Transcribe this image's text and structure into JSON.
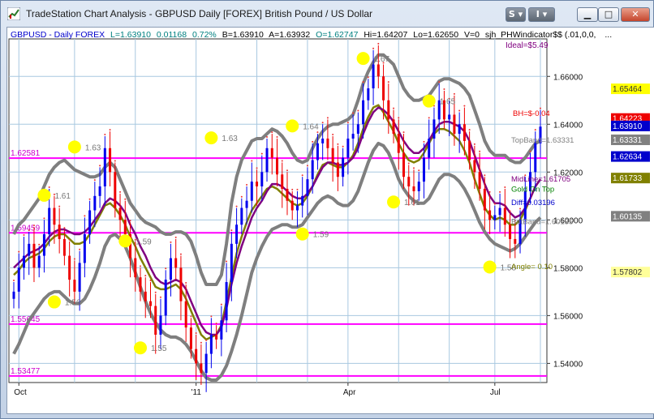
{
  "window": {
    "title": "TradeStation Chart Analysis - GBPUSD Daily [FOREX] British Pound / US Dollar",
    "buttons": {
      "s_label": "S",
      "i_label": "I",
      "minimize": "▁",
      "maximize": "□",
      "close": "✕"
    }
  },
  "header": {
    "symbol": "GBPUSD - Daily  FOREX",
    "last": "L=1.63910",
    "change": "0.01168",
    "pct": "0.72%",
    "bid": "B=1.63910",
    "ask": "A=1.63932",
    "open": "O=1.62747",
    "high": "Hi=1.64207",
    "low": "Lo=1.62650",
    "volume": "V=0",
    "indicator": "sjh_PHWindicator$$ (.01,0,0,",
    "indicator_more": "...",
    "ideal": "Ideal=$5.49"
  },
  "colors": {
    "up_bar": "#0000ee",
    "down_bar": "#ee0000",
    "band": "#7f7f7f",
    "midline": "#800080",
    "gold": "#808000",
    "hline": "#ff00ff",
    "dot": "#ffff00",
    "grid": "#a8c8e0"
  },
  "chart_data": {
    "type": "candlestick",
    "ylim": [
      1.532,
      1.675
    ],
    "y_ticks": [
      "1.66000",
      "1.64000",
      "1.62000",
      "1.60000",
      "1.58000",
      "1.56000",
      "1.54000"
    ],
    "x_ticks": [
      "Oct",
      "'11",
      "Apr",
      "Jul"
    ],
    "horizontal_lines": [
      {
        "label": "1.62581",
        "value": 1.62581
      },
      {
        "label": "1.59459",
        "value": 1.59459
      },
      {
        "label": "1.55645",
        "value": 1.55645
      },
      {
        "label": "1.53477",
        "value": 1.53477
      }
    ],
    "right_price_tags": [
      {
        "label": "1.65464",
        "value": 1.65464,
        "bg": "#ffff00",
        "fg": "#333333"
      },
      {
        "label": "1.64223",
        "value": 1.64223,
        "bg": "#ee0000",
        "fg": "#ffffff"
      },
      {
        "label": "1.63910",
        "value": 1.6391,
        "bg": "#0000cc",
        "fg": "#ffffff"
      },
      {
        "label": "1.63331",
        "value": 1.63331,
        "bg": "#808080",
        "fg": "#ffffff"
      },
      {
        "label": "1.62634",
        "value": 1.62634,
        "bg": "#0000cc",
        "fg": "#ffffff"
      },
      {
        "label": "1.61733",
        "value": 1.61733,
        "bg": "#808000",
        "fg": "#ffffff"
      },
      {
        "label": "1.60135",
        "value": 1.60135,
        "bg": "#808080",
        "fg": "#ffffff"
      },
      {
        "label": "1.57802",
        "value": 1.57802,
        "bg": "#ffff99",
        "fg": "#333333"
      }
    ],
    "swing_labels": [
      {
        "text": "1.61",
        "value": 1.6103
      },
      {
        "text": "1.56",
        "value": 1.5657
      },
      {
        "text": "1.63",
        "value": 1.6305
      },
      {
        "text": "1.59",
        "value": 1.5912
      },
      {
        "text": "1.55",
        "value": 1.5465
      },
      {
        "text": "1.63",
        "value": 1.6343
      },
      {
        "text": "1.64",
        "value": 1.6393
      },
      {
        "text": "1.59",
        "value": 1.5941
      },
      {
        "text": "1.67",
        "value": 1.6675
      },
      {
        "text": "1.65",
        "value": 1.6497
      },
      {
        "text": "1.61",
        "value": 1.6075
      },
      {
        "text": "1.58",
        "value": 1.5803
      }
    ],
    "annotations": [
      {
        "text": "BH=$-0.04",
        "color": "#ee0000"
      },
      {
        "text": "TopBand=1.63331",
        "color": "#808080"
      },
      {
        "text": "MidLine=1.61705",
        "color": "#800080"
      },
      {
        "text": "Gold On Top",
        "color": "#008000"
      },
      {
        "text": "Diff=0.03196",
        "color": "#0000cc"
      },
      {
        "text": "BotBand=1.60135",
        "color": "#808080"
      },
      {
        "text": "Angle= 0.10",
        "color": "#808000"
      }
    ],
    "series": [
      {
        "name": "close",
        "values": [
          1.57,
          1.58,
          1.585,
          1.59,
          1.58,
          1.585,
          1.594,
          1.605,
          1.598,
          1.592,
          1.585,
          1.575,
          1.57,
          1.582,
          1.594,
          1.604,
          1.61,
          1.614,
          1.63,
          1.62,
          1.605,
          1.6,
          1.594,
          1.584,
          1.576,
          1.57,
          1.566,
          1.564,
          1.552,
          1.56,
          1.575,
          1.584,
          1.58,
          1.566,
          1.555,
          1.546,
          1.54,
          1.536,
          1.544,
          1.552,
          1.55,
          1.558,
          1.574,
          1.59,
          1.598,
          1.605,
          1.608,
          1.616,
          1.614,
          1.62,
          1.63,
          1.626,
          1.619,
          1.613,
          1.608,
          1.604,
          1.606,
          1.61,
          1.617,
          1.625,
          1.632,
          1.634,
          1.63,
          1.624,
          1.618,
          1.626,
          1.634,
          1.636,
          1.64,
          1.65,
          1.655,
          1.665,
          1.66,
          1.65,
          1.642,
          1.636,
          1.628,
          1.618,
          1.614,
          1.612,
          1.616,
          1.626,
          1.634,
          1.642,
          1.65,
          1.642,
          1.644,
          1.636,
          1.64,
          1.633,
          1.625,
          1.62,
          1.613,
          1.604,
          1.6,
          1.602,
          1.605,
          1.598,
          1.592,
          1.59,
          1.6,
          1.612,
          1.62,
          1.632,
          1.639
        ]
      }
    ],
    "bands": {
      "top": [
        1.594,
        1.598,
        1.6,
        1.603,
        1.606,
        1.609,
        1.614,
        1.619,
        1.622,
        1.624,
        1.625,
        1.623,
        1.621,
        1.62,
        1.619,
        1.618,
        1.618,
        1.619,
        1.622,
        1.624,
        1.622,
        1.617,
        1.612,
        1.607,
        1.604,
        1.601,
        1.599,
        1.598,
        1.597,
        1.595,
        1.594,
        1.594,
        1.595,
        1.595,
        1.594,
        1.591,
        1.585,
        1.578,
        1.573,
        1.573,
        1.573,
        1.577,
        1.59,
        1.607,
        1.618,
        1.625,
        1.629,
        1.633,
        1.634,
        1.634,
        1.636,
        1.638,
        1.637,
        1.635,
        1.632,
        1.628,
        1.625,
        1.624,
        1.625,
        1.63,
        1.634,
        1.637,
        1.639,
        1.64,
        1.64,
        1.641,
        1.642,
        1.644,
        1.65,
        1.657,
        1.662,
        1.666,
        1.669,
        1.669,
        1.667,
        1.665,
        1.66,
        1.655,
        1.652,
        1.65,
        1.65,
        1.651,
        1.652,
        1.655,
        1.658,
        1.659,
        1.659,
        1.658,
        1.657,
        1.655,
        1.652,
        1.646,
        1.64,
        1.633,
        1.629,
        1.627,
        1.627,
        1.627,
        1.625,
        1.624,
        1.624,
        1.626,
        1.629,
        1.632,
        1.633
      ],
      "mid": [
        1.58,
        1.582,
        1.584,
        1.586,
        1.587,
        1.588,
        1.59,
        1.593,
        1.595,
        1.596,
        1.596,
        1.595,
        1.594,
        1.594,
        1.595,
        1.597,
        1.6,
        1.603,
        1.607,
        1.609,
        1.608,
        1.606,
        1.603,
        1.598,
        1.594,
        1.589,
        1.585,
        1.58,
        1.576,
        1.574,
        1.573,
        1.574,
        1.575,
        1.574,
        1.571,
        1.566,
        1.561,
        1.556,
        1.553,
        1.552,
        1.552,
        1.555,
        1.563,
        1.573,
        1.582,
        1.589,
        1.595,
        1.601,
        1.605,
        1.608,
        1.612,
        1.615,
        1.615,
        1.614,
        1.612,
        1.61,
        1.609,
        1.609,
        1.611,
        1.614,
        1.618,
        1.622,
        1.624,
        1.624,
        1.623,
        1.623,
        1.624,
        1.626,
        1.63,
        1.636,
        1.641,
        1.645,
        1.647,
        1.646,
        1.644,
        1.641,
        1.637,
        1.633,
        1.63,
        1.628,
        1.628,
        1.63,
        1.633,
        1.637,
        1.64,
        1.641,
        1.641,
        1.64,
        1.639,
        1.637,
        1.633,
        1.627,
        1.621,
        1.615,
        1.61,
        1.607,
        1.607,
        1.606,
        1.603,
        1.601,
        1.602,
        1.605,
        1.609,
        1.614,
        1.617
      ],
      "gold": [
        1.577,
        1.579,
        1.582,
        1.584,
        1.585,
        1.586,
        1.588,
        1.591,
        1.593,
        1.594,
        1.594,
        1.592,
        1.59,
        1.59,
        1.591,
        1.594,
        1.598,
        1.602,
        1.606,
        1.607,
        1.605,
        1.602,
        1.598,
        1.593,
        1.589,
        1.584,
        1.58,
        1.576,
        1.572,
        1.571,
        1.571,
        1.572,
        1.573,
        1.571,
        1.567,
        1.562,
        1.557,
        1.552,
        1.55,
        1.551,
        1.552,
        1.556,
        1.566,
        1.576,
        1.586,
        1.593,
        1.599,
        1.604,
        1.607,
        1.61,
        1.613,
        1.614,
        1.613,
        1.611,
        1.609,
        1.607,
        1.606,
        1.607,
        1.61,
        1.614,
        1.619,
        1.623,
        1.624,
        1.623,
        1.622,
        1.622,
        1.624,
        1.627,
        1.632,
        1.638,
        1.643,
        1.647,
        1.648,
        1.645,
        1.641,
        1.637,
        1.632,
        1.628,
        1.625,
        1.624,
        1.625,
        1.628,
        1.632,
        1.636,
        1.638,
        1.638,
        1.637,
        1.635,
        1.633,
        1.629,
        1.624,
        1.617,
        1.611,
        1.605,
        1.602,
        1.6,
        1.601,
        1.6,
        1.598,
        1.598,
        1.6,
        1.604,
        1.609,
        1.614,
        1.617
      ],
      "bottom": [
        1.544,
        1.548,
        1.553,
        1.558,
        1.561,
        1.564,
        1.567,
        1.569,
        1.57,
        1.57,
        1.568,
        1.566,
        1.565,
        1.565,
        1.567,
        1.571,
        1.576,
        1.582,
        1.589,
        1.593,
        1.594,
        1.592,
        1.589,
        1.584,
        1.578,
        1.572,
        1.566,
        1.561,
        1.557,
        1.554,
        1.552,
        1.551,
        1.551,
        1.55,
        1.548,
        1.545,
        1.541,
        1.537,
        1.534,
        1.533,
        1.533,
        1.535,
        1.539,
        1.545,
        1.552,
        1.56,
        1.569,
        1.578,
        1.584,
        1.589,
        1.593,
        1.596,
        1.597,
        1.598,
        1.598,
        1.597,
        1.597,
        1.598,
        1.601,
        1.604,
        1.607,
        1.609,
        1.61,
        1.609,
        1.607,
        1.606,
        1.606,
        1.608,
        1.612,
        1.618,
        1.624,
        1.629,
        1.632,
        1.631,
        1.628,
        1.623,
        1.617,
        1.613,
        1.61,
        1.608,
        1.607,
        1.607,
        1.609,
        1.613,
        1.617,
        1.619,
        1.619,
        1.618,
        1.616,
        1.613,
        1.609,
        1.604,
        1.599,
        1.595,
        1.592,
        1.59,
        1.589,
        1.588,
        1.587,
        1.588,
        1.59,
        1.593,
        1.596,
        1.599,
        1.601
      ]
    },
    "grid": true
  }
}
